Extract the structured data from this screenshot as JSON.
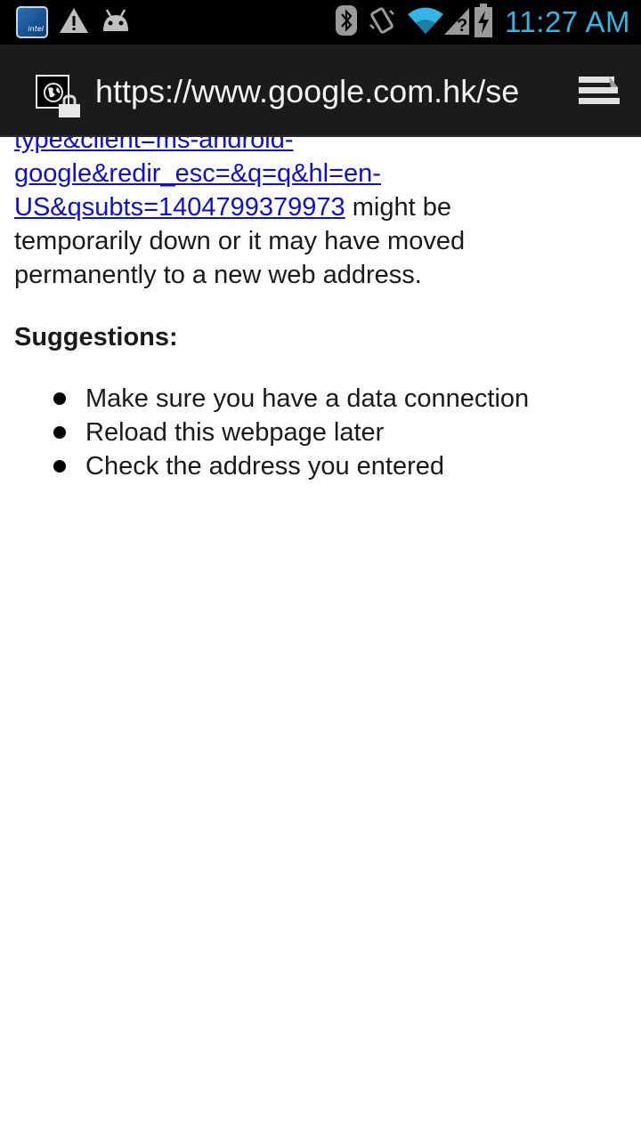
{
  "status_bar": {
    "time": "11:27 AM",
    "icons": [
      "intel-app-icon",
      "warning-icon",
      "android-debug-icon",
      "bluetooth-icon",
      "vibrate-icon",
      "wifi-icon",
      "signal-no-sim-icon",
      "battery-charging-icon"
    ],
    "accent_color": "#33b5e5"
  },
  "url_bar": {
    "url": "https://www.google.com.hk/se",
    "icons": [
      "site-globe-icon",
      "lock-icon",
      "menu-icon"
    ]
  },
  "page": {
    "url_fragment_line0": "type&client=ms-android-",
    "url_fragment_line1": "google&redir_esc=&q=q&hl=en-",
    "url_fragment_line2": "US&qsubts=1404799379973",
    "after_link": " might be",
    "text_line3": "temporarily down or it may have moved",
    "text_line4": "permanently to a new web address.",
    "suggestions_heading": "Suggestions:",
    "suggestions": [
      "Make sure you have a data connection",
      "Reload this webpage later",
      "Check the address you entered"
    ],
    "link_color": "#0e0ed4"
  }
}
